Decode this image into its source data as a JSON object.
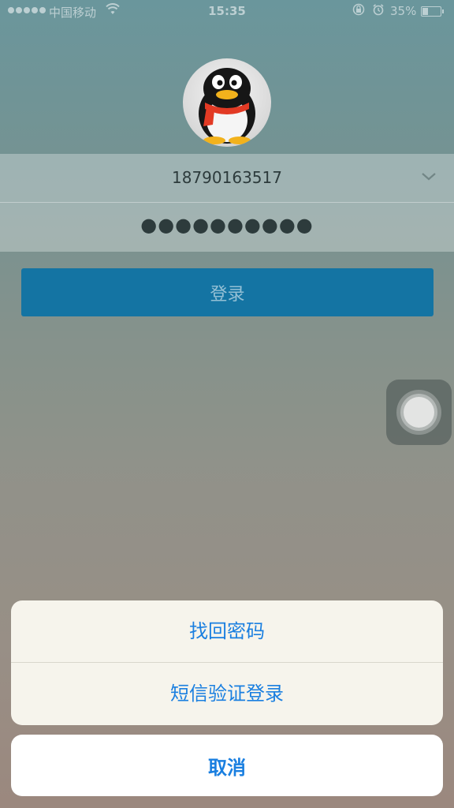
{
  "status_bar": {
    "carrier": "中国移动",
    "time": "15:35",
    "battery": "35%",
    "battery_level": 0.35,
    "icons": [
      "signal-dots-icon",
      "wifi-icon",
      "orientation-lock-icon",
      "alarm-icon",
      "battery-icon"
    ]
  },
  "login": {
    "account": "18790163517",
    "password_mask": "●●●●●●●●●●",
    "login_label": "登录"
  },
  "action_sheet": {
    "items": [
      {
        "label": "找回密码"
      },
      {
        "label": "短信验证登录"
      }
    ],
    "cancel_label": "取消"
  },
  "colors": {
    "accent": "#1a7fe0",
    "login_button": "#1474a3"
  }
}
